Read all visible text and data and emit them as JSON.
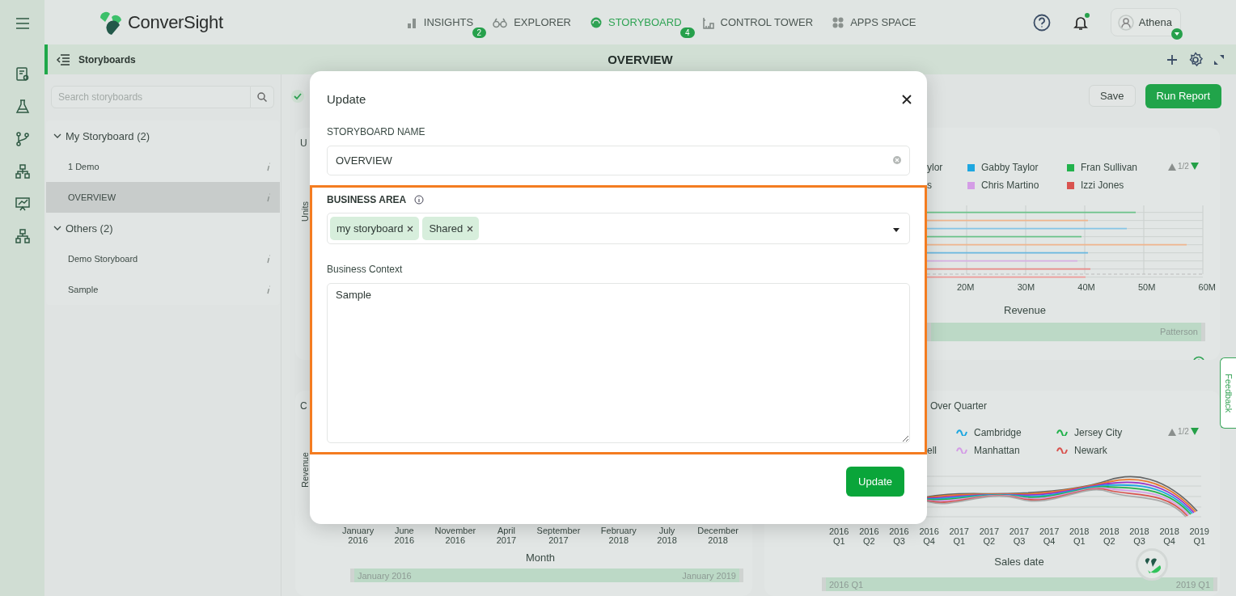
{
  "top_bar": {
    "brand": "ConverSight",
    "nav": [
      {
        "label": "INSIGHTS",
        "badge": "2",
        "selected": false
      },
      {
        "label": "EXPLORER",
        "selected": false
      },
      {
        "label": "STORYBOARD",
        "badge": "4",
        "selected": true
      },
      {
        "label": "CONTROL TOWER",
        "selected": false
      },
      {
        "label": "APPS SPACE",
        "selected": false
      }
    ],
    "notifications": {
      "unread": true
    },
    "user": {
      "name": "Athena"
    }
  },
  "storyboard_header": {
    "label": "Storyboards",
    "title": "OVERVIEW"
  },
  "sidebar": {
    "search": {
      "placeholder": "Search storyboards"
    },
    "groups": [
      {
        "label": "My Storyboard (2)",
        "expanded": true,
        "children": [
          {
            "label": "1 Demo",
            "selected": false
          },
          {
            "label": "OVERVIEW",
            "selected": true
          }
        ]
      },
      {
        "label": "Others (2)",
        "expanded": true,
        "children": [
          {
            "label": "Demo Storyboard",
            "selected": false
          },
          {
            "label": "Sample",
            "selected": false
          }
        ]
      }
    ]
  },
  "toolbar": {
    "checked": true,
    "buttons": [
      {
        "label": "Save",
        "kind": "secondary"
      },
      {
        "label": "Run Report",
        "kind": "primary"
      }
    ]
  },
  "charts": [
    {
      "kind": "covered",
      "title": "U",
      "ylabel": "Units"
    },
    {
      "kind": "bar",
      "legend_rows": [
        [
          {
            "label": "ylor"
          },
          {
            "label": "Gabby Taylor",
            "color": "#1ea7e0"
          },
          {
            "label": "Fran Sullivan",
            "color": "#22b24c"
          }
        ],
        [
          {
            "label": "s"
          },
          {
            "label": "Chris Martino",
            "color": "#d49de6"
          },
          {
            "label": "Izzi Jones",
            "color": "#d9534f"
          }
        ]
      ],
      "pager": "1/2",
      "xticks": [
        "20M",
        "30M",
        "40M",
        "50M",
        "60M"
      ],
      "xlabel": "Revenue",
      "range": {
        "labels": [
          "Patterson"
        ],
        "level": 1
      }
    },
    {
      "kind": "covered",
      "title": "C",
      "ylabel": "Revenue",
      "xticks": [
        "January 2016",
        "June 2016",
        "November 2016",
        "April 2017",
        "September 2017",
        "February 2018",
        "July 2018",
        "December 2018"
      ],
      "xlabel": "Month",
      "range": {
        "labels": [
          "January 2016",
          "January 2019"
        ],
        "level": 1
      }
    },
    {
      "kind": "line",
      "title": "Over Quarter",
      "legend_rows": [
        [
          {
            "label": "Cambridge",
            "color": "#1ea7e0"
          },
          {
            "label": "Jersey City",
            "color": "#22b24c"
          }
        ],
        [
          {
            "label": "ell"
          },
          {
            "label": "Manhattan",
            "color": "#d49de6"
          },
          {
            "label": "Newark",
            "color": "#d9534f"
          }
        ]
      ],
      "pager": "1/2",
      "xticks": [
        "2016 Q1",
        "2016 Q2",
        "2016 Q3",
        "2016 Q4",
        "2017 Q1",
        "2017 Q2",
        "2017 Q3",
        "2017 Q4",
        "2018 Q1",
        "2018 Q2",
        "2018 Q3",
        "2018 Q4",
        "2019 Q1"
      ],
      "xlabel": "Sales date",
      "range": {
        "labels": [
          "2016 Q1",
          "2019 Q1"
        ],
        "level": 1
      }
    }
  ],
  "modal": {
    "title": "Update",
    "name_label": "STORYBOARD NAME",
    "name_value": "OVERVIEW",
    "area_label": "BUSINESS AREA",
    "area_tags": [
      "my storyboard",
      "Shared"
    ],
    "context_label": "Business Context",
    "context_value": "Sample",
    "button": "Update"
  },
  "feedback_tab": {
    "label": "Feedback"
  }
}
